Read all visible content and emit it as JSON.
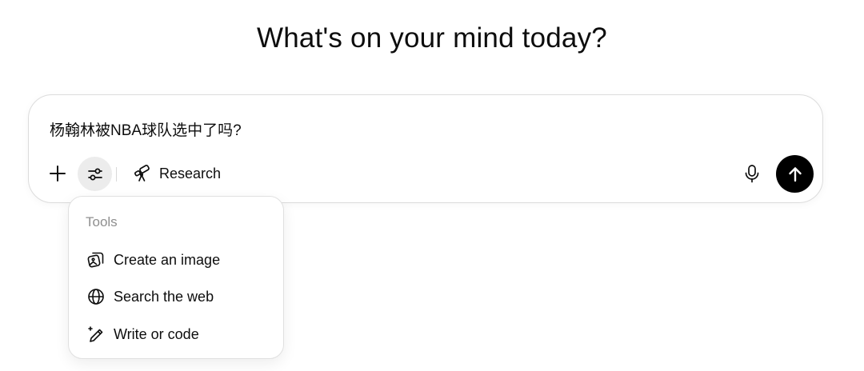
{
  "headline": "What's on your mind today?",
  "composer": {
    "prompt_value": "杨翰林被NBA球队选中了吗?",
    "add_icon": "plus-icon",
    "tools_icon": "sliders-icon",
    "research_label": "Research",
    "research_icon": "telescope-icon",
    "mic_icon": "microphone-icon",
    "send_icon": "arrow-up-icon"
  },
  "tools_menu": {
    "heading": "Tools",
    "items": [
      {
        "label": "Create an image",
        "icon": "image-icon"
      },
      {
        "label": "Search the web",
        "icon": "globe-icon"
      },
      {
        "label": "Write or code",
        "icon": "pen-sparkle-icon"
      }
    ]
  },
  "colors": {
    "send_button": "#000000",
    "tools_button_bg": "#ececec",
    "menu_heading": "#8f8f8f"
  }
}
